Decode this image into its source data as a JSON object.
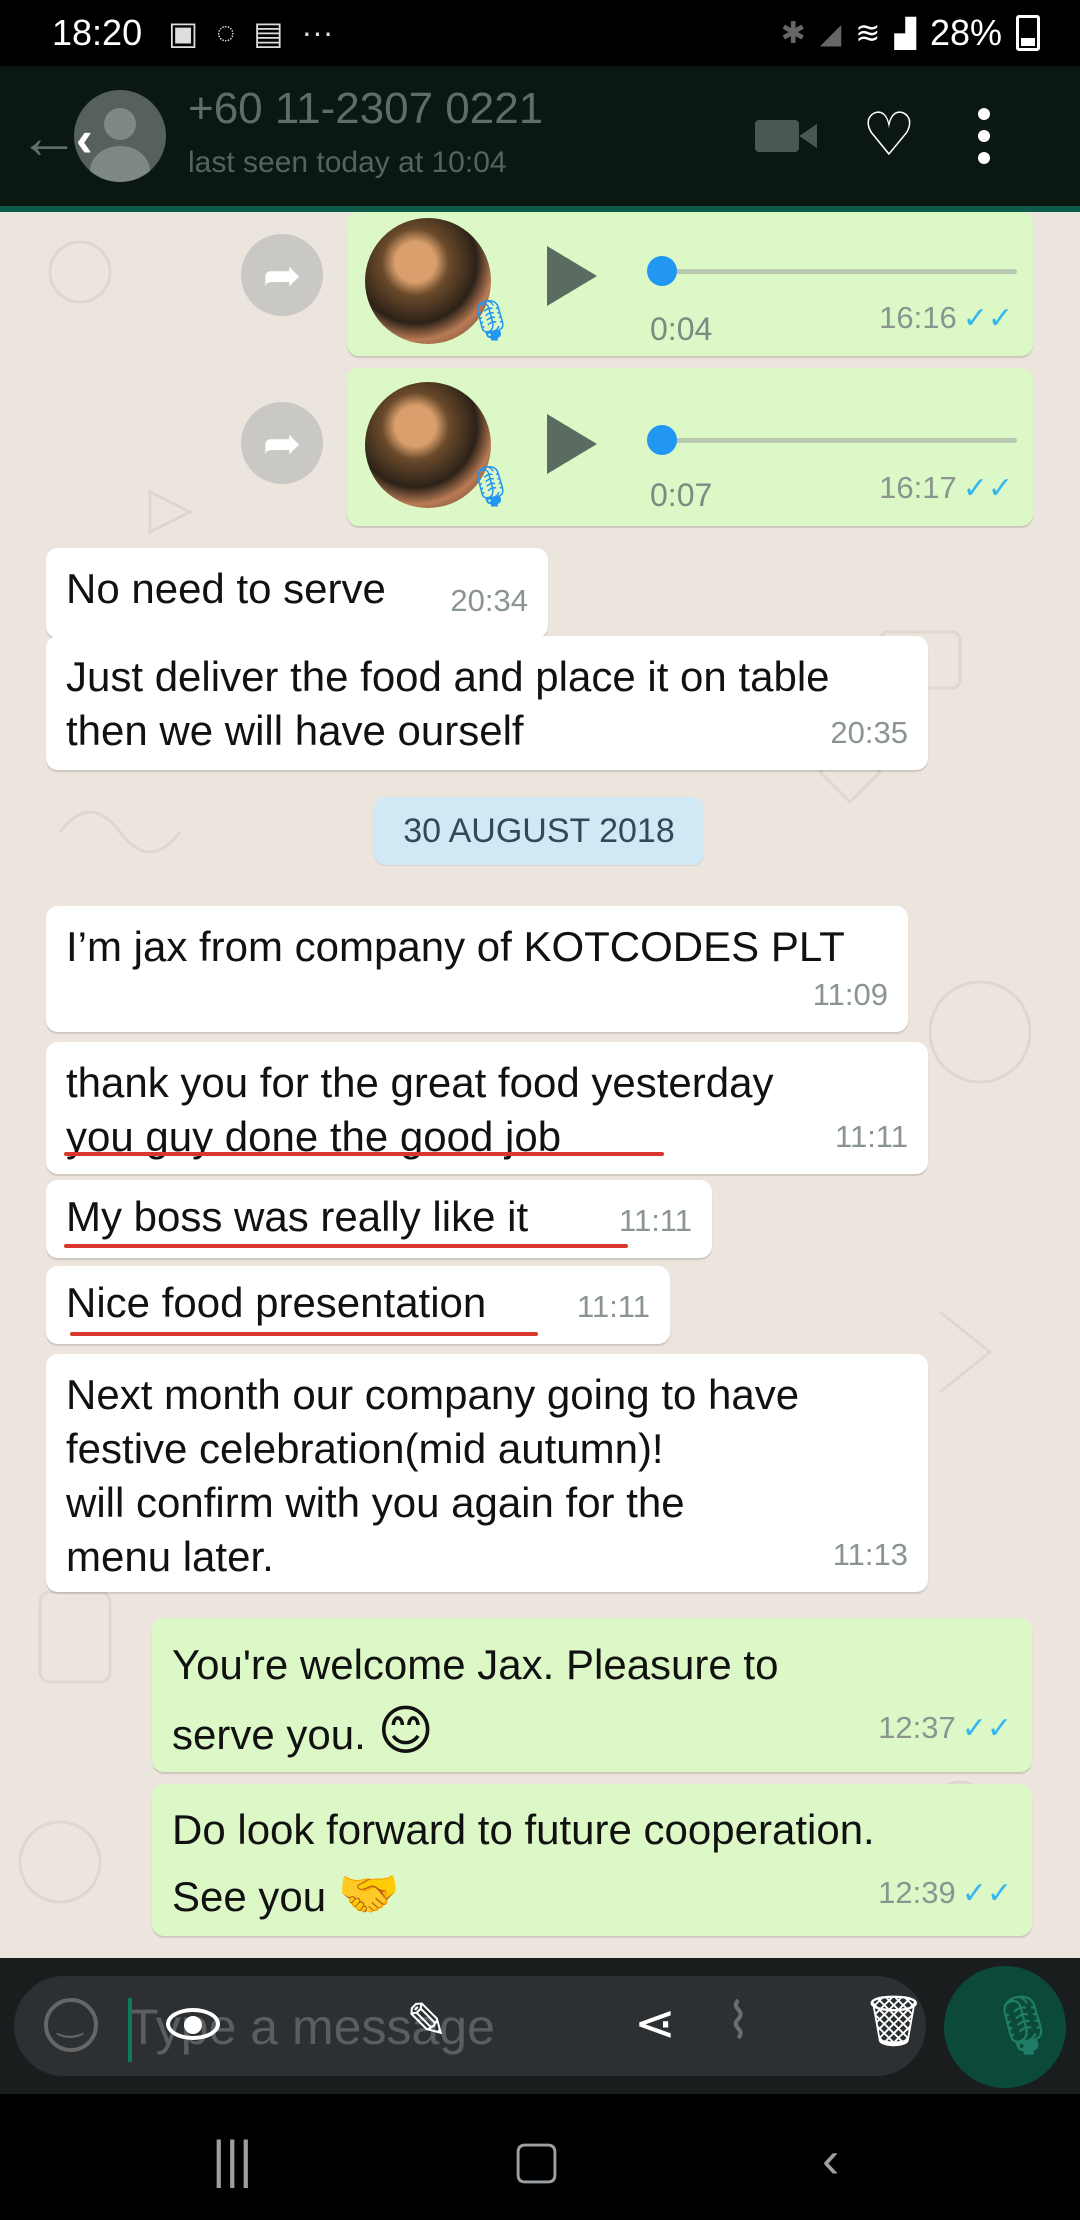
{
  "status_bar": {
    "time": "18:20",
    "battery": "28%"
  },
  "header": {
    "contact_name": "+60 11-2307 0221",
    "last_seen": "last seen today at 10:04"
  },
  "messages": [
    {
      "type": "audio",
      "direction": "out",
      "duration": "0:04",
      "time": "16:16"
    },
    {
      "type": "audio",
      "direction": "out",
      "duration": "0:07",
      "time": "16:17"
    },
    {
      "type": "text",
      "direction": "in",
      "text": "No need to serve",
      "time": "20:34"
    },
    {
      "type": "text",
      "direction": "in",
      "lines": [
        "Just deliver the food and place it on table",
        "then we will have ourself"
      ],
      "time": "20:35"
    },
    {
      "type": "date",
      "text": "30 AUGUST 2018"
    },
    {
      "type": "text",
      "direction": "in",
      "text": "I’m jax from company of KOTCODES PLT",
      "time": "11:09"
    },
    {
      "type": "text",
      "direction": "in",
      "lines": [
        "thank you for the great food yesterday",
        "you guy done the good job"
      ],
      "time": "11:11"
    },
    {
      "type": "text",
      "direction": "in",
      "text": "My boss was really like it",
      "time": "11:11"
    },
    {
      "type": "text",
      "direction": "in",
      "text": "Nice food presentation",
      "time": "11:11"
    },
    {
      "type": "text",
      "direction": "in",
      "lines": [
        "Next month our company going to have",
        "festive celebration(mid autumn)!",
        "will confirm with you again for the",
        "menu later."
      ],
      "time": "11:13"
    },
    {
      "type": "text",
      "direction": "out",
      "lines": [
        "You're welcome Jax. Pleasure to",
        "serve you."
      ],
      "emoji": "😊",
      "time": "12:37"
    },
    {
      "type": "text",
      "direction": "out",
      "lines": [
        "Do look forward to future cooperation.",
        "See you"
      ],
      "emoji": "🤝",
      "time": "12:39"
    }
  ],
  "input": {
    "placeholder": "Type a message"
  },
  "icons": {
    "emoji": "emoji-icon",
    "eye": "eye-icon",
    "pencil": "pencil-icon",
    "share": "share-icon",
    "attach": "paperclip-icon",
    "delete": "trash-icon",
    "mic": "mic-icon"
  },
  "colors": {
    "incoming_bubble": "#ffffff",
    "outgoing_bubble": "#dcf8c6",
    "read_ticks": "#34b7f1",
    "underline": "#d9362c",
    "date_pill": "#d1e9f5"
  }
}
